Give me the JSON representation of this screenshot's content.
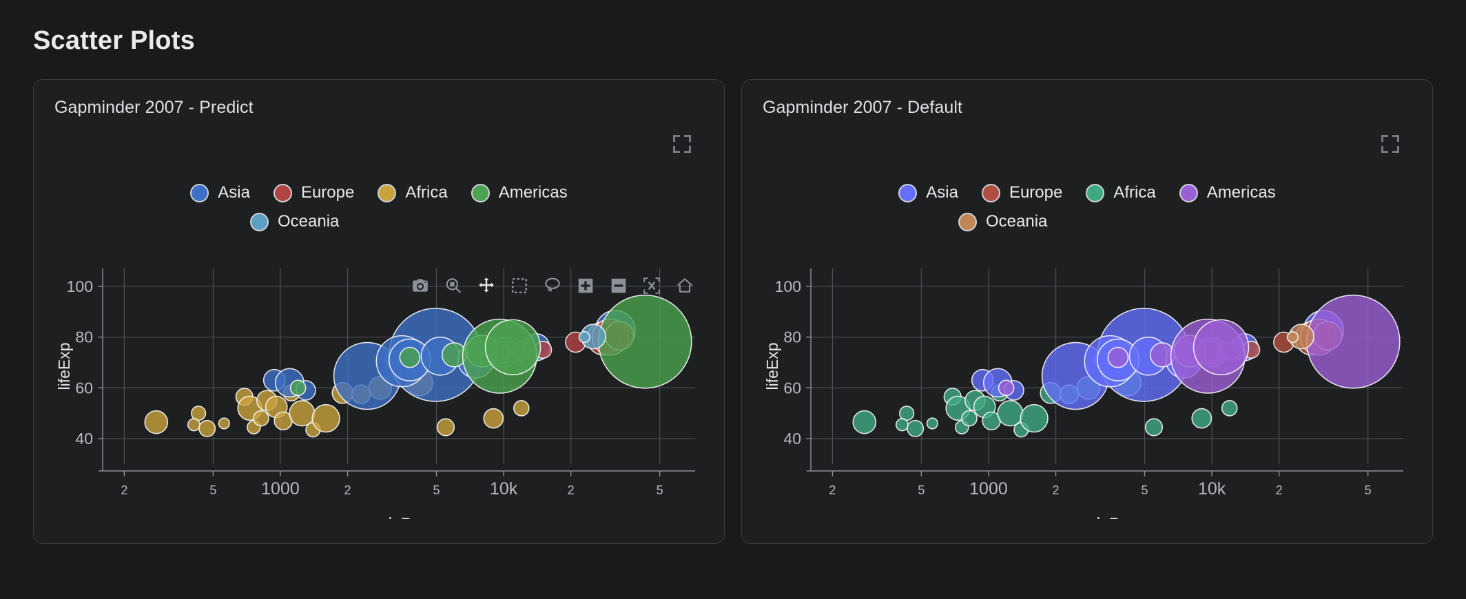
{
  "page": {
    "title": "Scatter Plots"
  },
  "icons": {
    "expand": "expand-icon",
    "modebar": [
      {
        "name": "download-camera-icon",
        "title": "Download plot as a png"
      },
      {
        "name": "zoom-magnifier-icon",
        "title": "Zoom"
      },
      {
        "name": "pan-move-icon",
        "title": "Pan"
      },
      {
        "name": "box-select-icon",
        "title": "Box Select"
      },
      {
        "name": "lasso-select-icon",
        "title": "Lasso Select"
      },
      {
        "name": "zoom-in-plus-icon",
        "title": "Zoom in"
      },
      {
        "name": "zoom-out-minus-icon",
        "title": "Zoom out"
      },
      {
        "name": "autoscale-icon",
        "title": "Autoscale"
      },
      {
        "name": "reset-home-icon",
        "title": "Reset axes"
      }
    ]
  },
  "cards": [
    {
      "id": "predict",
      "title": "Gapminder 2007 - Predict",
      "legend": [
        {
          "label": "Asia",
          "color": "#3d6fc4"
        },
        {
          "label": "Europe",
          "color": "#b24343"
        },
        {
          "label": "Africa",
          "color": "#c9a33c"
        },
        {
          "label": "Americas",
          "color": "#4ba24f"
        },
        {
          "label": "Oceania",
          "color": "#5ba0c2"
        }
      ],
      "has_modebar": true
    },
    {
      "id": "default",
      "title": "Gapminder 2007 - Default",
      "legend": [
        {
          "label": "Asia",
          "color": "#636efa"
        },
        {
          "label": "Europe",
          "color": "#b04f41"
        },
        {
          "label": "Africa",
          "color": "#3faa82"
        },
        {
          "label": "Americas",
          "color": "#9b5fd6"
        },
        {
          "label": "Oceania",
          "color": "#c18657"
        }
      ],
      "has_modebar": false
    }
  ],
  "chart_data": [
    {
      "type": "scatter",
      "title": "Gapminder 2007 - Predict",
      "xlabel": "gdpPercap",
      "ylabel": "lifeExp",
      "xaxis_type": "log",
      "yaxis_type": "linear",
      "xtick_labels": [
        "2",
        "5",
        "1000",
        "2",
        "5",
        "10k",
        "2",
        "5"
      ],
      "xtick_values": [
        200,
        500,
        1000,
        2000,
        5000,
        10000,
        20000,
        50000
      ],
      "ytick_labels": [
        "40",
        "60",
        "80",
        "100"
      ],
      "ytick_values": [
        40,
        60,
        80,
        100
      ],
      "ylim": [
        30,
        107
      ],
      "xlim": [
        160,
        72000
      ],
      "grid": true,
      "legend_position": "top-center",
      "size_encoding": "population",
      "series": [
        {
          "name": "Asia",
          "color": "#3d6fc4"
        },
        {
          "name": "Europe",
          "color": "#b24343"
        },
        {
          "name": "Africa",
          "color": "#c9a33c"
        },
        {
          "name": "Americas",
          "color": "#4ba24f"
        },
        {
          "name": "Oceania",
          "color": "#5ba0c2"
        }
      ],
      "points": [
        {
          "continent": "Africa",
          "x": 278,
          "y": 46.5,
          "pop": 18
        },
        {
          "continent": "Africa",
          "x": 430,
          "y": 50.0,
          "pop": 7
        },
        {
          "continent": "Africa",
          "x": 410,
          "y": 45.5,
          "pop": 5
        },
        {
          "continent": "Africa",
          "x": 470,
          "y": 44.0,
          "pop": 9
        },
        {
          "continent": "Africa",
          "x": 560,
          "y": 46.0,
          "pop": 4
        },
        {
          "continent": "Africa",
          "x": 690,
          "y": 56.5,
          "pop": 10
        },
        {
          "continent": "Africa",
          "x": 730,
          "y": 52.0,
          "pop": 20
        },
        {
          "continent": "Africa",
          "x": 760,
          "y": 44.5,
          "pop": 6
        },
        {
          "continent": "Africa",
          "x": 820,
          "y": 48.0,
          "pop": 8
        },
        {
          "continent": "Africa",
          "x": 870,
          "y": 55.0,
          "pop": 14
        },
        {
          "continent": "Africa",
          "x": 960,
          "y": 52.5,
          "pop": 16
        },
        {
          "continent": "Africa",
          "x": 1030,
          "y": 47.0,
          "pop": 11
        },
        {
          "continent": "Africa",
          "x": 1120,
          "y": 58.0,
          "pop": 9
        },
        {
          "continent": "Africa",
          "x": 1250,
          "y": 50.0,
          "pop": 22
        },
        {
          "continent": "Africa",
          "x": 1400,
          "y": 43.5,
          "pop": 7
        },
        {
          "continent": "Africa",
          "x": 1600,
          "y": 48.0,
          "pop": 26
        },
        {
          "continent": "Africa",
          "x": 1900,
          "y": 58.0,
          "pop": 15
        },
        {
          "continent": "Africa",
          "x": 2300,
          "y": 57.5,
          "pop": 12
        },
        {
          "continent": "Africa",
          "x": 2800,
          "y": 60.0,
          "pop": 18
        },
        {
          "continent": "Africa",
          "x": 3200,
          "y": 71.0,
          "pop": 9
        },
        {
          "continent": "Africa",
          "x": 4200,
          "y": 62.0,
          "pop": 24
        },
        {
          "continent": "Africa",
          "x": 5500,
          "y": 44.5,
          "pop": 10
        },
        {
          "continent": "Africa",
          "x": 9000,
          "y": 48.0,
          "pop": 13
        },
        {
          "continent": "Africa",
          "x": 12000,
          "y": 52.0,
          "pop": 8
        },
        {
          "continent": "Asia",
          "x": 940,
          "y": 63.0,
          "pop": 16
        },
        {
          "continent": "Asia",
          "x": 1100,
          "y": 62.0,
          "pop": 28
        },
        {
          "continent": "Asia",
          "x": 1300,
          "y": 59.0,
          "pop": 13
        },
        {
          "continent": "Asia",
          "x": 2450,
          "y": 64.7,
          "pop": 155
        },
        {
          "continent": "Asia",
          "x": 4960,
          "y": 73.0,
          "pop": 300
        },
        {
          "continent": "Asia",
          "x": 3500,
          "y": 70.5,
          "pop": 90
        },
        {
          "continent": "Asia",
          "x": 3800,
          "y": 71.0,
          "pop": 60
        },
        {
          "continent": "Asia",
          "x": 5200,
          "y": 72.5,
          "pop": 50
        },
        {
          "continent": "Asia",
          "x": 7500,
          "y": 71.0,
          "pop": 45
        },
        {
          "continent": "Asia",
          "x": 10000,
          "y": 74.0,
          "pop": 30
        },
        {
          "continent": "Asia",
          "x": 14000,
          "y": 76.0,
          "pop": 25
        },
        {
          "continent": "Asia",
          "x": 31600,
          "y": 82.6,
          "pop": 55
        },
        {
          "continent": "Europe",
          "x": 9500,
          "y": 74.0,
          "pop": 18
        },
        {
          "continent": "Europe",
          "x": 12000,
          "y": 74.5,
          "pop": 12
        },
        {
          "continent": "Europe",
          "x": 15000,
          "y": 75.0,
          "pop": 10
        },
        {
          "continent": "Europe",
          "x": 21000,
          "y": 78.0,
          "pop": 14
        },
        {
          "continent": "Europe",
          "x": 28000,
          "y": 79.5,
          "pop": 38
        },
        {
          "continent": "Europe",
          "x": 30000,
          "y": 80.0,
          "pop": 45
        },
        {
          "continent": "Europe",
          "x": 33000,
          "y": 80.5,
          "pop": 28
        },
        {
          "continent": "Americas",
          "x": 1200,
          "y": 60.0,
          "pop": 8
        },
        {
          "continent": "Americas",
          "x": 3800,
          "y": 72.0,
          "pop": 14
        },
        {
          "continent": "Americas",
          "x": 6000,
          "y": 73.0,
          "pop": 20
        },
        {
          "continent": "Americas",
          "x": 8000,
          "y": 74.5,
          "pop": 35
        },
        {
          "continent": "Americas",
          "x": 9600,
          "y": 72.5,
          "pop": 190
        },
        {
          "continent": "Americas",
          "x": 11000,
          "y": 76.0,
          "pop": 105
        },
        {
          "continent": "Americas",
          "x": 42950,
          "y": 78.2,
          "pop": 300
        },
        {
          "continent": "Oceania",
          "x": 25200,
          "y": 80.2,
          "pop": 21
        },
        {
          "continent": "Oceania",
          "x": 23000,
          "y": 80.0,
          "pop": 4
        }
      ]
    },
    {
      "type": "scatter",
      "title": "Gapminder 2007 - Default",
      "xlabel": "gdpPercap",
      "ylabel": "lifeExp",
      "xaxis_type": "log",
      "yaxis_type": "linear",
      "xtick_labels": [
        "2",
        "5",
        "1000",
        "2",
        "5",
        "10k",
        "2",
        "5"
      ],
      "ytick_labels": [
        "40",
        "60",
        "80",
        "100"
      ],
      "ylim": [
        30,
        107
      ],
      "xlim": [
        160,
        72000
      ],
      "grid": true,
      "legend_position": "top-center",
      "size_encoding": "population",
      "series": [
        {
          "name": "Asia",
          "color": "#636efa"
        },
        {
          "name": "Europe",
          "color": "#b04f41"
        },
        {
          "name": "Africa",
          "color": "#3faa82"
        },
        {
          "name": "Americas",
          "color": "#9b5fd6"
        },
        {
          "name": "Oceania",
          "color": "#c18657"
        }
      ]
    }
  ]
}
